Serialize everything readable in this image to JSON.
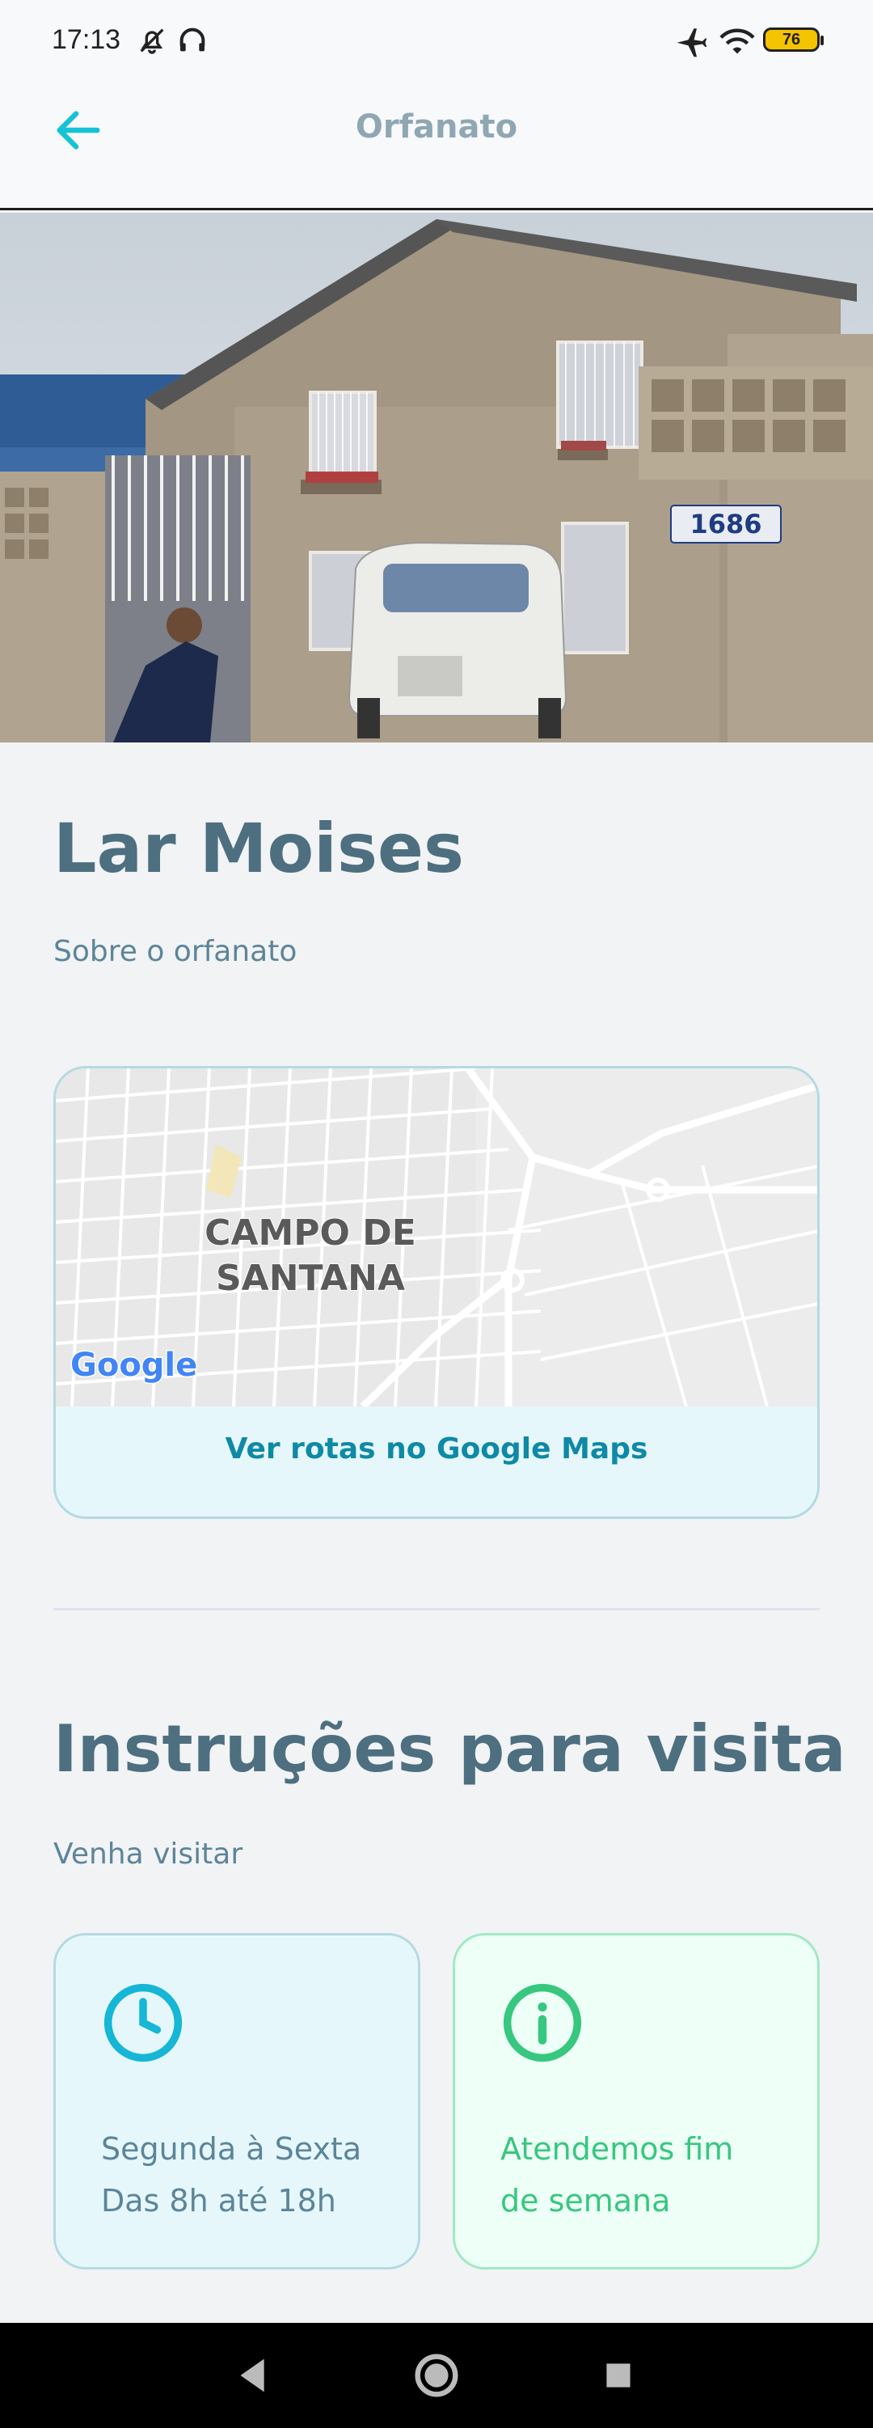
{
  "status_bar": {
    "time": "17:13",
    "battery": "76"
  },
  "header": {
    "title": "Orfanato"
  },
  "hero": {
    "house_number": "1686"
  },
  "orphanage": {
    "name": "Lar Moises",
    "about": "Sobre o orfanato"
  },
  "map": {
    "district_line1": "CAMPO DE",
    "district_line2": "SANTANA",
    "google_logo": "Google",
    "directions_label": "Ver rotas no Google Maps"
  },
  "visit": {
    "title": "Instruções para visita",
    "subtitle": "Venha visitar",
    "hours_line1": "Segunda à Sexta",
    "hours_line2": "Das 8h até 18h",
    "weekend_line1": "Atendemos fim",
    "weekend_line2": "de semana"
  },
  "colors": {
    "primary": "#15c3d6",
    "title": "#4d6f80",
    "link": "#0e89a6",
    "green": "#37c77f"
  }
}
